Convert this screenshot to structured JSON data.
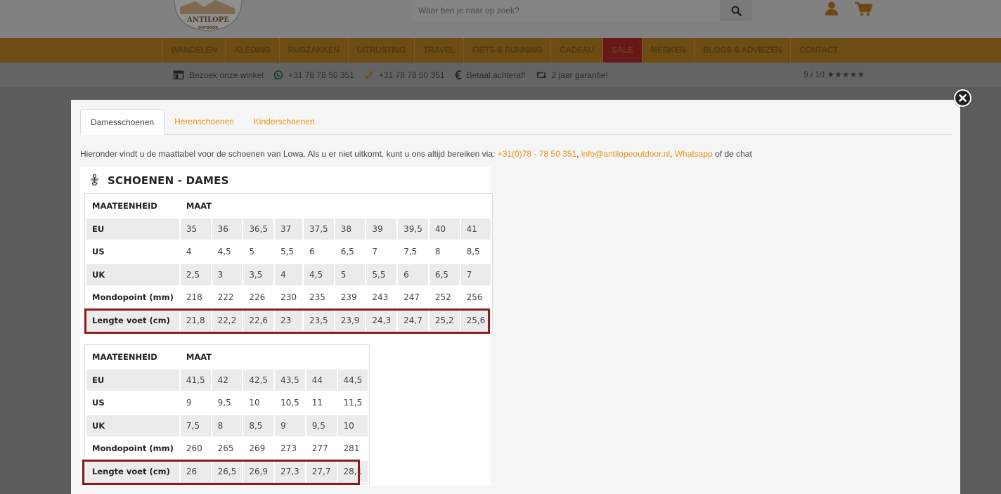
{
  "header": {
    "logo": {
      "brand": "ANTILOPE",
      "sub": "OUTDOOR"
    },
    "search": {
      "placeholder": "Waar ben je naar op zoek?"
    },
    "icons": [
      "search-icon",
      "user-icon",
      "cart-icon"
    ]
  },
  "nav": {
    "items": [
      {
        "label": "WANDELEN"
      },
      {
        "label": "KLEDING"
      },
      {
        "label": "RUGZAKKEN"
      },
      {
        "label": "UITRUSTING"
      },
      {
        "label": "TRAVEL"
      },
      {
        "label": "FIETS & RUNNING"
      },
      {
        "label": "CADEAU"
      },
      {
        "label": "SALE"
      },
      {
        "label": "MERKEN"
      },
      {
        "label": "BLOGS & ADVIEZEN"
      },
      {
        "label": "CONTACT"
      }
    ]
  },
  "usp": {
    "items": [
      {
        "icon": "store-icon",
        "label": "Bezoek onze winkel"
      },
      {
        "icon": "whatsapp-icon",
        "label": "+31 78 78 50 351"
      },
      {
        "icon": "phone-icon",
        "label": "+31 78 78 50 351"
      },
      {
        "icon": "euro-icon",
        "label": "Betaal achteraf!"
      },
      {
        "icon": "retweet-icon",
        "label": "2 jaar garantie!"
      }
    ],
    "rating": "9 / 10 ★★★★★"
  },
  "modal": {
    "tabs": [
      {
        "label": "Damesschoenen",
        "active": true
      },
      {
        "label": "Herenschoenen",
        "active": false
      },
      {
        "label": "Kinderschoenen",
        "active": false
      }
    ],
    "intro": {
      "text": "Hieronder vindt u de maattabel voor de schoenen van Lowa. Als u er niet uitkomt, kunt u ons altijd bereiken via: ",
      "phone": "+31(0)78 - 78 50 351",
      "sep": ", ",
      "email": "info@antilopeoutdoor.nl",
      "whatsapp": "Whatsapp",
      "tail": " of de chat"
    },
    "section_title": "SCHOENEN - DAMES",
    "tables": [
      {
        "header": [
          "MAATEENHEID",
          "MAAT"
        ],
        "rows": [
          {
            "label": "EU",
            "values": [
              "35",
              "36",
              "36,5",
              "37",
              "37,5",
              "38",
              "39",
              "39,5",
              "40",
              "41"
            ]
          },
          {
            "label": "US",
            "values": [
              "4",
              "4,5",
              "5",
              "5,5",
              "6",
              "6,5",
              "7",
              "7,5",
              "8",
              "8,5"
            ]
          },
          {
            "label": "UK",
            "values": [
              "2,5",
              "3",
              "3,5",
              "4",
              "4,5",
              "5",
              "5,5",
              "6",
              "6,5",
              "7"
            ]
          },
          {
            "label": "Mondopoint (mm)",
            "values": [
              "218",
              "222",
              "226",
              "230",
              "235",
              "239",
              "243",
              "247",
              "252",
              "256"
            ]
          },
          {
            "label": "Lengte voet (cm)",
            "values": [
              "21,8",
              "22,2",
              "22,6",
              "23",
              "23,5",
              "23,9",
              "24,3",
              "24,7",
              "25,2",
              "25,6"
            ]
          }
        ]
      },
      {
        "header": [
          "MAATEENHEID",
          "MAAT"
        ],
        "rows": [
          {
            "label": "EU",
            "values": [
              "41,5",
              "42",
              "42,5",
              "43,5",
              "44",
              "44,5"
            ]
          },
          {
            "label": "US",
            "values": [
              "9",
              "9,5",
              "10",
              "10,5",
              "11",
              "11,5"
            ]
          },
          {
            "label": "UK",
            "values": [
              "7,5",
              "8",
              "8,5",
              "9",
              "9,5",
              "10"
            ]
          },
          {
            "label": "Mondopoint (mm)",
            "values": [
              "260",
              "265",
              "269",
              "273",
              "277",
              "281"
            ]
          },
          {
            "label": "Lengte voet (cm)",
            "values": [
              "26",
              "26,5",
              "26,9",
              "27,3",
              "27,7",
              "28,1"
            ]
          }
        ]
      }
    ]
  },
  "colors": {
    "accent": "#e8951c",
    "highlight_border": "#8b1a1a",
    "nav_bg": "#6e4d14",
    "sale_bg": "#681818"
  }
}
